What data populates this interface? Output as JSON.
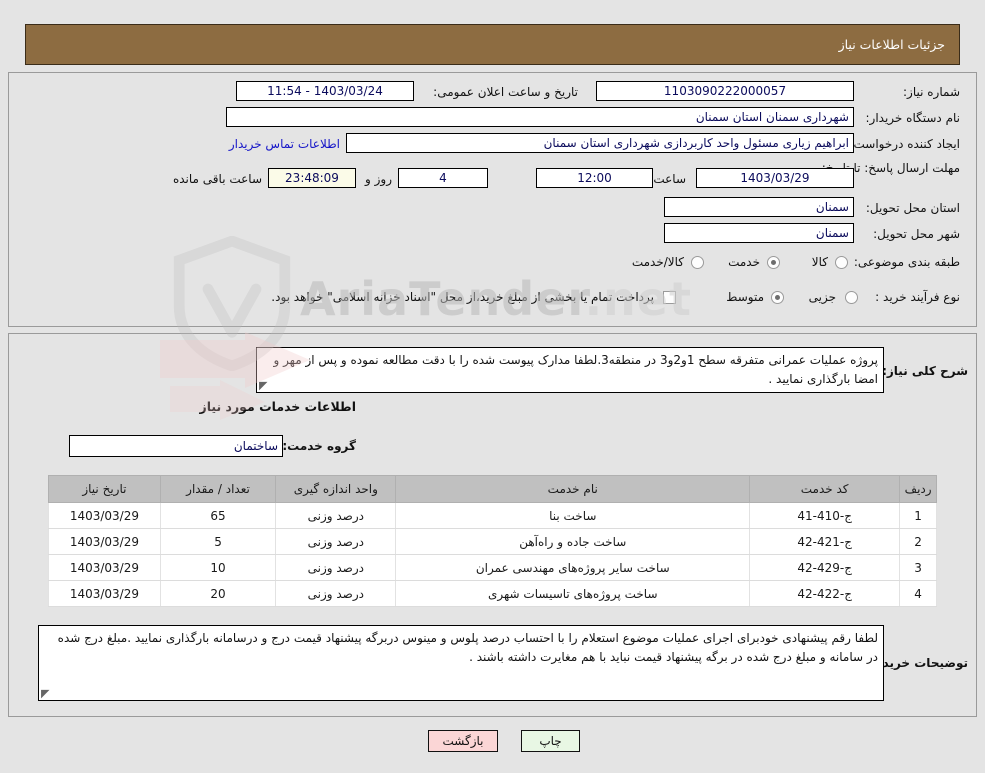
{
  "header": {
    "title": "جزئیات اطلاعات نیاز"
  },
  "form": {
    "need_number_label": "شماره نیاز:",
    "need_number_value": "1103090222000057",
    "announce_label": "تاریخ و ساعت اعلان عمومی:",
    "announce_value": "1403/03/24 - 11:54",
    "buyer_org_label": "نام دستگاه خریدار:",
    "buyer_org_value": "شهرداری سمنان استان سمنان",
    "requester_label": "ایجاد کننده درخواست:",
    "requester_value": "ابراهیم زیاری مسئول واحد کاربردازی شهرداری استان سمنان",
    "contact_link": "اطلاعات تماس خریدار",
    "deadline_label": "مهلت ارسال پاسخ: تا تاریخ:",
    "deadline_date": "1403/03/29",
    "hour_label": "ساعت",
    "deadline_time": "12:00",
    "days_value": "4",
    "days_label": "روز و",
    "countdown_value": "23:48:09",
    "countdown_label": "ساعت باقی مانده",
    "province_label": "استان محل تحویل:",
    "province_value": "سمنان",
    "city_label": "شهر محل تحویل:",
    "city_value": "سمنان",
    "category_label": "طبقه بندی موضوعی:",
    "category_options": [
      {
        "label": "کالا",
        "selected": false
      },
      {
        "label": "خدمت",
        "selected": true
      },
      {
        "label": "کالا/خدمت",
        "selected": false
      }
    ],
    "process_label": "نوع فرآیند خرید :",
    "process_options": [
      {
        "label": "جزیی",
        "selected": false
      },
      {
        "label": "متوسط",
        "selected": true
      }
    ],
    "treasury_checkbox_checked": false,
    "treasury_text": "پرداخت تمام یا بخشی از مبلغ خرید،از محل \"اسناد خزانه اسلامی\" خواهد بود."
  },
  "description": {
    "label": "شرح کلی نیاز:",
    "value": "پروژه عملیات عمرانی متفرقه سطح 1و2و3 در منطقه3.لطفا مدارک پیوست شده را با دقت مطالعه نموده و پس از مهر و امضا بارگذاری نمایید ."
  },
  "services": {
    "section_title": "اطلاعات خدمات مورد نیاز",
    "group_label": "گروه خدمت:",
    "group_value": "ساختمان",
    "columns": [
      "ردیف",
      "کد خدمت",
      "نام خدمت",
      "واحد اندازه گیری",
      "تعداد / مقدار",
      "تاریخ نیاز"
    ],
    "rows": [
      {
        "row": "1",
        "code": "ج-410-41",
        "name": "ساخت بنا",
        "unit": "درصد وزنی",
        "qty": "65",
        "date": "1403/03/29"
      },
      {
        "row": "2",
        "code": "ج-421-42",
        "name": "ساخت جاده و راه‌آهن",
        "unit": "درصد وزنی",
        "qty": "5",
        "date": "1403/03/29"
      },
      {
        "row": "3",
        "code": "ج-429-42",
        "name": "ساخت سایر پروژه‌های مهندسی عمران",
        "unit": "درصد وزنی",
        "qty": "10",
        "date": "1403/03/29"
      },
      {
        "row": "4",
        "code": "ج-422-42",
        "name": "ساخت پروژه‌های تاسیسات شهری",
        "unit": "درصد وزنی",
        "qty": "20",
        "date": "1403/03/29"
      }
    ]
  },
  "buyer_notes": {
    "label": "توضیحات خریدار:",
    "value": "لطفا رقم پیشنهادی خودبرای اجرای عملیات موضوع استعلام را با احتساب درصد پلوس و مینوس دربرگه پیشنهاد قیمت درج و درسامانه بارگذاری نمایید .مبلغ درج شده در سامانه و مبلغ درج شده در برگه پیشنهاد قیمت نباید با هم مغایرت داشته باشند ."
  },
  "footer": {
    "print_label": "چاپ",
    "back_label": "بازگشت"
  },
  "watermark": {
    "text": "AriaTender",
    "suffix": ".net"
  },
  "colors": {
    "header_bg": "#8d6c41",
    "page_bg": "#e4e4e4",
    "link": "#1616c8",
    "field_text": "#0b0b5c",
    "table_header_bg": "#c0c0c0",
    "print_btn_bg": "#e8f7e4",
    "back_btn_bg": "#fbd6d6"
  }
}
